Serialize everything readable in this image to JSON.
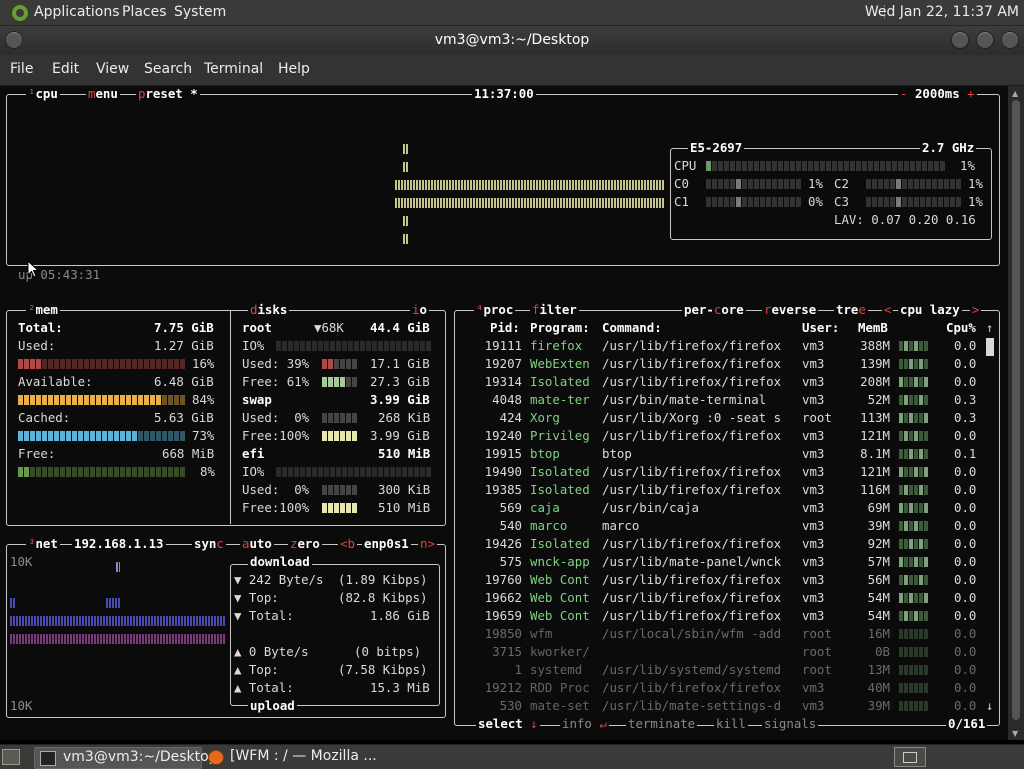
{
  "topbar": {
    "menus": [
      "Applications",
      "Places",
      "System"
    ],
    "clock": "Wed Jan 22, 11:37 AM"
  },
  "window": {
    "title": "vm3@vm3:~/Desktop",
    "menus": [
      "File",
      "Edit",
      "View",
      "Search",
      "Terminal",
      "Help"
    ]
  },
  "cpu": {
    "tab_num": "¹",
    "tab": "cpu",
    "menu": "menu",
    "preset": "preset *",
    "time": "11:37:00",
    "interval": "2000ms",
    "uptime": "up 05:43:31",
    "model": "E5-2697",
    "freq": "2.7 GHz",
    "total_label": "CPU",
    "total_pct": "1%",
    "cores": [
      {
        "name": "C0",
        "pct": "1%"
      },
      {
        "name": "C1",
        "pct": "0%"
      },
      {
        "name": "C2",
        "pct": "1%"
      },
      {
        "name": "C3",
        "pct": "1%"
      }
    ],
    "lav": "LAV: 0.07 0.20 0.16"
  },
  "mem": {
    "tab_num": "²",
    "tab": "mem",
    "total": {
      "label": "Total:",
      "value": "7.75 GiB"
    },
    "used": {
      "label": "Used:",
      "value": "1.27 GiB",
      "pct": "16%"
    },
    "available": {
      "label": "Available:",
      "value": "6.48 GiB",
      "pct": "84%"
    },
    "cached": {
      "label": "Cached:",
      "value": "5.63 GiB",
      "pct": "73%"
    },
    "free": {
      "label": "Free:",
      "value": "668 MiB",
      "pct": "8%"
    }
  },
  "disks": {
    "tab": "disks",
    "io_tab": "io",
    "root": {
      "name": "root",
      "io_speed": "▼68K",
      "size": "44.4 GiB",
      "io_label": "IO%",
      "used_label": "Used: 39%",
      "used": "17.1 GiB",
      "free_label": "Free: 61%",
      "free": "27.3 GiB"
    },
    "swap": {
      "name": "swap",
      "size": "3.99 GiB",
      "used_label": "Used:  0%",
      "used": "268 KiB",
      "free_label": "Free:100%",
      "free": "3.99 GiB"
    },
    "efi": {
      "name": "efi",
      "size": "510 MiB",
      "io_label": "IO%",
      "used_label": "Used:  0%",
      "used": "300 KiB",
      "free_label": "Free:100%",
      "free": "510 MiB"
    }
  },
  "net": {
    "tab_num": "³",
    "tab": "net",
    "ip": "192.168.1.13",
    "sync": "sync",
    "auto": "auto",
    "zero": "zero",
    "prev": "<b",
    "iface": "enp0s1",
    "next": "n>",
    "scale_top": "10K",
    "scale_bottom": "10K",
    "download": {
      "label": "download",
      "rate": "242 Byte/s",
      "rate_bits": "(1.89 Kibps)",
      "top_label": "Top:",
      "top": "(82.8 Kibps)",
      "total_label": "Total:",
      "total": "1.86 GiB"
    },
    "upload": {
      "label": "upload",
      "rate": "0 Byte/s",
      "rate_bits": "(0 bitps)",
      "top_label": "Top:",
      "top": "(7.58 Kibps)",
      "total_label": "Total:",
      "total": "15.3 MiB"
    }
  },
  "proc": {
    "tab_num": "⁴",
    "tab": "proc",
    "filter": "filter",
    "per_core": "per-core",
    "reverse": "reverse",
    "tree": "tree",
    "sort_prev": "<",
    "sort": "cpu lazy",
    "sort_next": ">",
    "headers": {
      "pid": "Pid:",
      "program": "Program:",
      "command": "Command:",
      "user": "User:",
      "mem": "MemB",
      "cpu": "Cpu%"
    },
    "rows": [
      {
        "pid": "19111",
        "program": "firefox",
        "command": "/usr/lib/firefox/firefox",
        "user": "vm3",
        "mem": "388M",
        "cpu": "0.0"
      },
      {
        "pid": "19207",
        "program": "WebExten",
        "command": "/usr/lib/firefox/firefox",
        "user": "vm3",
        "mem": "139M",
        "cpu": "0.0"
      },
      {
        "pid": "19314",
        "program": "Isolated",
        "command": "/usr/lib/firefox/firefox",
        "user": "vm3",
        "mem": "208M",
        "cpu": "0.0"
      },
      {
        "pid": "4048",
        "program": "mate-ter",
        "command": "/usr/bin/mate-terminal",
        "user": "vm3",
        "mem": "52M",
        "cpu": "0.3"
      },
      {
        "pid": "424",
        "program": "Xorg",
        "command": "/usr/lib/Xorg :0 -seat s",
        "user": "root",
        "mem": "113M",
        "cpu": "0.3"
      },
      {
        "pid": "19240",
        "program": "Privileg",
        "command": "/usr/lib/firefox/firefox",
        "user": "vm3",
        "mem": "121M",
        "cpu": "0.0"
      },
      {
        "pid": "19915",
        "program": "btop",
        "command": "btop",
        "user": "vm3",
        "mem": "8.1M",
        "cpu": "0.1"
      },
      {
        "pid": "19490",
        "program": "Isolated",
        "command": "/usr/lib/firefox/firefox",
        "user": "vm3",
        "mem": "121M",
        "cpu": "0.0"
      },
      {
        "pid": "19385",
        "program": "Isolated",
        "command": "/usr/lib/firefox/firefox",
        "user": "vm3",
        "mem": "116M",
        "cpu": "0.0"
      },
      {
        "pid": "569",
        "program": "caja",
        "command": "/usr/bin/caja",
        "user": "vm3",
        "mem": "69M",
        "cpu": "0.0"
      },
      {
        "pid": "540",
        "program": "marco",
        "command": "marco",
        "user": "vm3",
        "mem": "39M",
        "cpu": "0.0"
      },
      {
        "pid": "19426",
        "program": "Isolated",
        "command": "/usr/lib/firefox/firefox",
        "user": "vm3",
        "mem": "92M",
        "cpu": "0.0"
      },
      {
        "pid": "575",
        "program": "wnck-app",
        "command": "/usr/lib/mate-panel/wnck",
        "user": "vm3",
        "mem": "57M",
        "cpu": "0.0"
      },
      {
        "pid": "19760",
        "program": "Web Cont",
        "command": "/usr/lib/firefox/firefox",
        "user": "vm3",
        "mem": "56M",
        "cpu": "0.0"
      },
      {
        "pid": "19662",
        "program": "Web Cont",
        "command": "/usr/lib/firefox/firefox",
        "user": "vm3",
        "mem": "54M",
        "cpu": "0.0"
      },
      {
        "pid": "19659",
        "program": "Web Cont",
        "command": "/usr/lib/firefox/firefox",
        "user": "vm3",
        "mem": "54M",
        "cpu": "0.0"
      },
      {
        "pid": "19850",
        "program": "wfm",
        "command": "/usr/local/sbin/wfm -add",
        "user": "root",
        "mem": "16M",
        "cpu": "0.0"
      },
      {
        "pid": "3715",
        "program": "kworker/",
        "command": "",
        "user": "root",
        "mem": "0B",
        "cpu": "0.0"
      },
      {
        "pid": "1",
        "program": "systemd",
        "command": "/usr/lib/systemd/systemd",
        "user": "root",
        "mem": "13M",
        "cpu": "0.0"
      },
      {
        "pid": "19212",
        "program": "RDD Proc",
        "command": "/usr/lib/firefox/firefox",
        "user": "vm3",
        "mem": "40M",
        "cpu": "0.0"
      },
      {
        "pid": "530",
        "program": "mate-set",
        "command": "/usr/lib/mate-settings-d",
        "user": "vm3",
        "mem": "39M",
        "cpu": "0.0"
      }
    ],
    "footer": {
      "select": "select",
      "info": "info",
      "terminate": "terminate",
      "kill": "kill",
      "signals": "signals",
      "count": "0/161"
    }
  },
  "taskbar": {
    "items": [
      "vm3@vm3:~/Desktop",
      "[WFM : / — Mozilla ..."
    ]
  },
  "colors": {
    "accent": "#e0413a",
    "cpu_graph": "#c7c68a",
    "mem_used": "#b04848",
    "mem_avail": "#e7b04a",
    "mem_cached": "#5fb3d6",
    "mem_free": "#6a9a48",
    "net_down": "#4a4ab0",
    "net_up": "#7a3a7a"
  }
}
